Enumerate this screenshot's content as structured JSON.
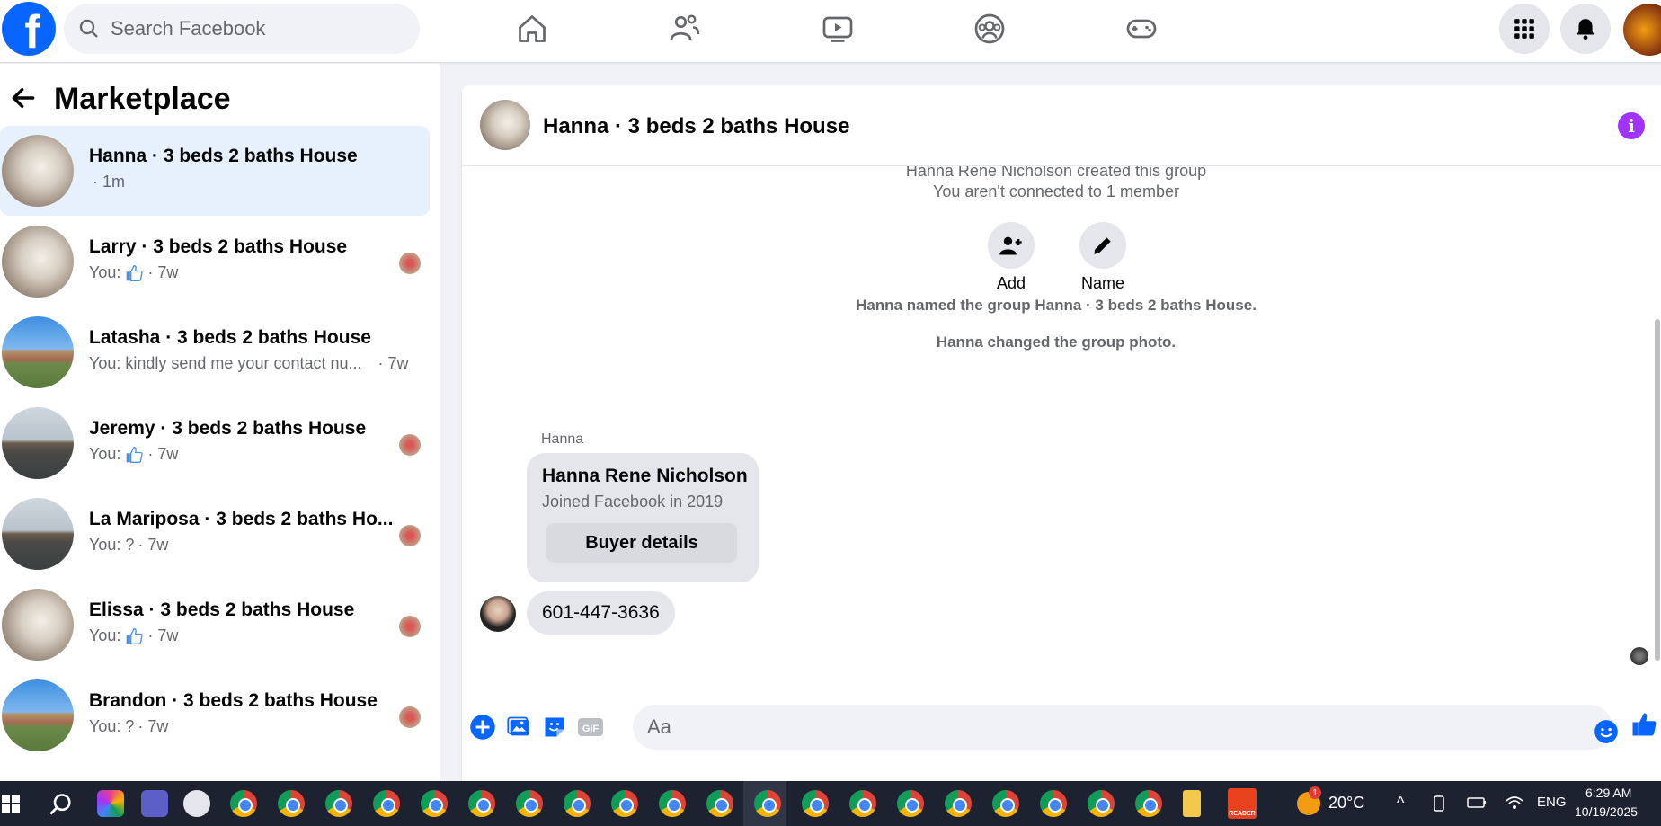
{
  "topbar": {
    "logo": "f",
    "search_placeholder": "Search Facebook",
    "nav_icons": [
      "home-icon",
      "friends-icon",
      "watch-icon",
      "groups-icon",
      "gaming-icon"
    ],
    "right_icons": [
      "menu-grid-icon",
      "bell-icon",
      "profile-avatar"
    ]
  },
  "sidebar": {
    "title": "Marketplace",
    "conversations": [
      {
        "name": "Hanna · 3 beds 2 baths House",
        "preview": "",
        "time": "· 1m",
        "active": true,
        "thumb": "room"
      },
      {
        "name": "Larry · 3 beds 2 baths House",
        "preview": "You:",
        "time": "· 7w",
        "like": true,
        "thumb": "room"
      },
      {
        "name": "Latasha · 3 beds 2 baths House",
        "preview": "You: kindly send me your contact nu...",
        "time": "· 7w",
        "thumb": "house"
      },
      {
        "name": "Jeremy · 3 beds 2 baths House",
        "preview": "You:",
        "time": "· 7w",
        "like": true,
        "thumb": "tree"
      },
      {
        "name": "La Mariposa · 3 beds 2 baths Ho...",
        "preview": "You: ?",
        "time": "· 7w",
        "thumb": "tree"
      },
      {
        "name": "Elissa · 3 beds 2 baths House",
        "preview": "You:",
        "time": "· 7w",
        "like": true,
        "thumb": "room"
      },
      {
        "name": "Brandon · 3 beds 2 baths House",
        "preview": "You: ?",
        "time": "· 7w",
        "thumb": "house"
      }
    ]
  },
  "chat": {
    "title": "Hanna · 3 beds 2 baths House",
    "created_line": "Hanna Rene Nicholson created this group",
    "connected_line": "You aren't connected to 1 member",
    "add_label": "Add",
    "name_label": "Name",
    "named_event": "Hanna named the group Hanna · 3 beds 2 baths House.",
    "photo_event": "Hanna changed the group photo.",
    "sender": "Hanna",
    "profile_card": {
      "name": "Hanna Rene Nicholson",
      "joined": "Joined Facebook in 2019",
      "button": "Buyer details"
    },
    "message": "601-447-3636",
    "composer_placeholder": "Aa"
  },
  "taskbar": {
    "temperature": "20°C",
    "language": "ENG",
    "time": "6:29 AM",
    "date": "10/19/2025",
    "weather_badge": "1",
    "reader_label": "READER"
  },
  "colors": {
    "brand": "#0866ff",
    "active_conv": "#e7f0fd",
    "info": "#a033ff"
  }
}
